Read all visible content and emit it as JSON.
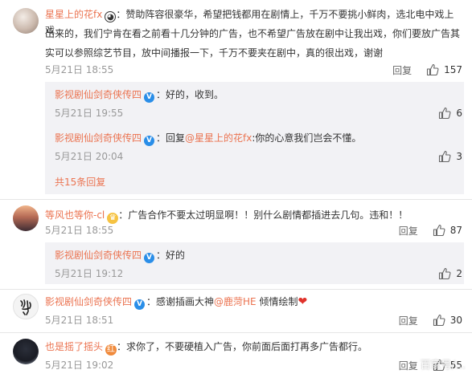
{
  "comments": [
    {
      "user": "星星上的花fx",
      "text": "：赞助阵容很豪华，希望把钱都用在剧情上，千万不要挑小鲜肉，选北电中戏上戏出来的，我们宁肯在看之前看十几分钟的广告，也不希望广告放在剧中让我出戏，你们要放广告其实可以参照综艺节目，放中间播报一下，千万不要夹在剧中，真的很出戏，谢谢",
      "text_line1": "：赞助阵容很豪华，希望把钱都用在剧情上，千万不要挑小鲜肉，选北电中戏上戏",
      "text_line2": "出来的，我们宁肯在看之前看十几分钟的广告，也不希望广告放在剧中让我出戏，你们要放广告其",
      "text_line3": "实可以参照综艺节目，放中间播报一下，千万不要夹在剧中，真的很出戏，谢谢",
      "date": "5月21日 18:55",
      "reply_label": "回复",
      "likes": "157",
      "replies": [
        {
          "user": "影视剧仙剑奇侠传四",
          "text": "：好的，收到。",
          "date": "5月21日 19:55",
          "likes": "6"
        },
        {
          "user": "影视剧仙剑奇侠传四",
          "text_prefix": "：回复",
          "mention": "@星星上的花fx",
          "text": ":你的心意我们岂会不懂。",
          "date": "5月21日 20:04",
          "likes": "3"
        }
      ],
      "more_replies": "共15条回复"
    },
    {
      "user": "等风也等你-cl",
      "text": "：广告合作不要太过明显啊！！别什么剧情都插进去几句。违和！！",
      "date": "5月21日 18:55",
      "reply_label": "回复",
      "likes": "87",
      "replies": [
        {
          "user": "影视剧仙剑奇侠传四",
          "text": "：好的",
          "date": "5月21日 19:12",
          "likes": "2"
        }
      ]
    },
    {
      "user": "影视剧仙剑奇侠传四",
      "text_prefix": "：感谢插画大神",
      "mention": "@鹿菏HE",
      "text": " 倾情绘制",
      "date": "5月21日 18:51",
      "reply_label": "回复",
      "likes": "30"
    },
    {
      "user": "也是摇了摇头",
      "text": "：求你了，不要硬植入广告，你前面后面打再多广告都行。",
      "date": "5月21日 19:02",
      "reply_label": "回复",
      "likes": "55"
    }
  ],
  "watermark": "百家号/…",
  "colors": {
    "username": "#eb7350",
    "subbg": "#f2f2f5",
    "verified": "#2a8ee8"
  }
}
